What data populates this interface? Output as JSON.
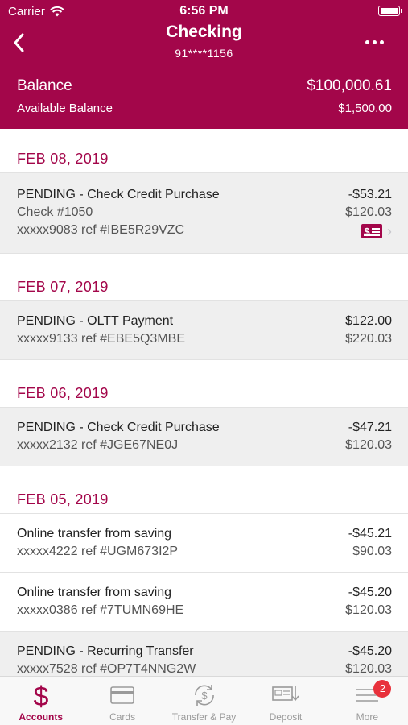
{
  "status": {
    "carrier": "Carrier",
    "time": "6:56 PM"
  },
  "nav": {
    "title": "Checking",
    "account": "91****1156"
  },
  "balance": {
    "label": "Balance",
    "value": "$100,000.61",
    "available_label": "Available Balance",
    "available_value": "$1,500.00"
  },
  "groups": [
    {
      "date": "FEB 08, 2019",
      "transactions": [
        {
          "title": "PENDING - Check Credit Purchase",
          "check": "Check #1050",
          "ref": "xxxxx9083 ref #IBE5R29VZC",
          "amount": "-$53.21",
          "balance": "$120.03",
          "pending": true,
          "has_check_image": true
        }
      ]
    },
    {
      "date": "FEB 07, 2019",
      "transactions": [
        {
          "title": "PENDING - OLTT Payment",
          "ref": "xxxxx9133 ref #EBE5Q3MBE",
          "amount": "$122.00",
          "balance": "$220.03",
          "pending": true
        }
      ]
    },
    {
      "date": "FEB 06, 2019",
      "transactions": [
        {
          "title": "PENDING - Check Credit Purchase",
          "ref": "xxxxx2132 ref #JGE67NE0J",
          "amount": "-$47.21",
          "balance": "$120.03",
          "pending": true
        }
      ]
    },
    {
      "date": "FEB 05, 2019",
      "transactions": [
        {
          "title": "Online transfer from saving",
          "ref": "xxxxx4222 ref #UGM673I2P",
          "amount": "-$45.21",
          "balance": "$90.03",
          "pending": false
        },
        {
          "title": "Online transfer from saving",
          "ref": "xxxxx0386 ref #7TUMN69HE",
          "amount": "-$45.20",
          "balance": "$120.03",
          "pending": false
        },
        {
          "title": "PENDING - Recurring Transfer",
          "ref": "xxxxx7528 ref #OP7T4NNG2W",
          "amount": "-$45.20",
          "balance": "$120.03",
          "pending": true
        }
      ]
    }
  ],
  "tabs": [
    {
      "label": "Accounts",
      "icon": "dollar-icon",
      "active": true
    },
    {
      "label": "Cards",
      "icon": "card-icon",
      "active": false
    },
    {
      "label": "Transfer & Pay",
      "icon": "transfer-icon",
      "active": false
    },
    {
      "label": "Deposit",
      "icon": "deposit-icon",
      "active": false
    },
    {
      "label": "More",
      "icon": "menu-icon",
      "active": false,
      "badge": "2"
    }
  ],
  "colors": {
    "brand": "#a3064a",
    "pending_bg": "#efefef",
    "badge": "#e8313b"
  }
}
